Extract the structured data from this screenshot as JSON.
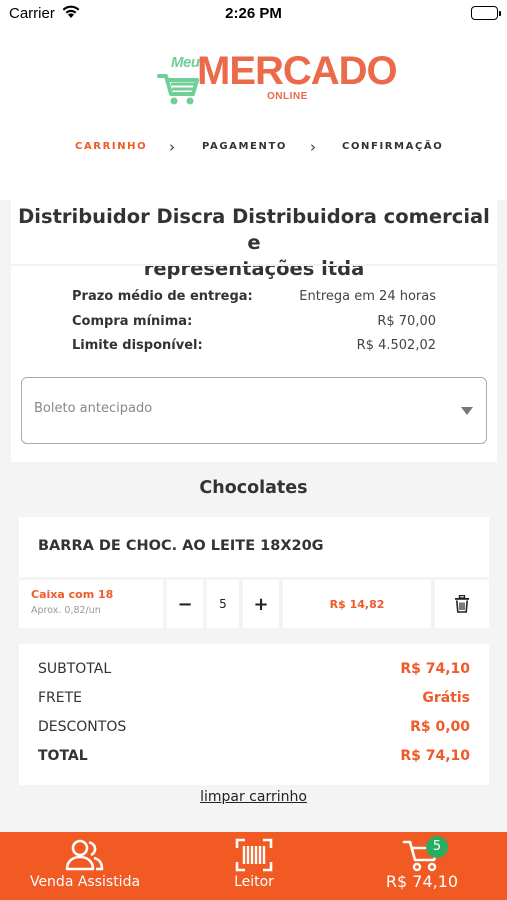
{
  "status_bar": {
    "carrier": "Carrier",
    "time": "2:26 PM"
  },
  "logo": {
    "meu": "Meu",
    "mercado": "MERCADO",
    "online": "ONLINE"
  },
  "steps": [
    {
      "label": "CARRINHO",
      "active": true
    },
    {
      "label": "PAGAMENTO",
      "active": false
    },
    {
      "label": "CONFIRMAÇÃO",
      "active": false
    }
  ],
  "distributor": {
    "name_line1": "Distribuidor Discra Distribuidora comercial e",
    "name_line2": "representações ltda",
    "info": [
      {
        "label": "Prazo médio de entrega:",
        "value": "Entrega em 24 horas"
      },
      {
        "label": "Compra mínima:",
        "value": "R$ 70,00"
      },
      {
        "label": "Limite disponível:",
        "value": "R$ 4.502,02"
      }
    ],
    "payment_method": "Boleto antecipado"
  },
  "category": "Chocolates",
  "product": {
    "name": "BARRA DE CHOC. AO LEITE 18X20G",
    "unit": "Caixa com 18",
    "unit_approx": "Aprox. 0,82/un",
    "minus_glyph": "−",
    "quantity": "5",
    "plus_glyph": "+",
    "price": "R$ 14,82"
  },
  "totals": [
    {
      "label": "SUBTOTAL",
      "value": "R$ 74,10"
    },
    {
      "label": "FRETE",
      "value": "Grátis"
    },
    {
      "label": "DESCONTOS",
      "value": "R$ 0,00"
    },
    {
      "label": "TOTAL",
      "value": "R$ 74,10"
    }
  ],
  "clear_cart": "limpar carrinho",
  "bottom_bar": {
    "assisted_sale": "Venda Assistida",
    "reader": "Leitor",
    "cart_total": "R$ 74,10",
    "cart_count": "5"
  },
  "colors": {
    "accent": "#f15a22",
    "logo_green": "#6fcf97",
    "badge_green": "#27ae60"
  },
  "icons": [
    "wifi-icon",
    "battery-icon",
    "cart-logo-icon",
    "chevron-right-icon",
    "dropdown-arrow-icon",
    "trash-icon",
    "users-icon",
    "barcode-scanner-icon",
    "cart-icon"
  ]
}
